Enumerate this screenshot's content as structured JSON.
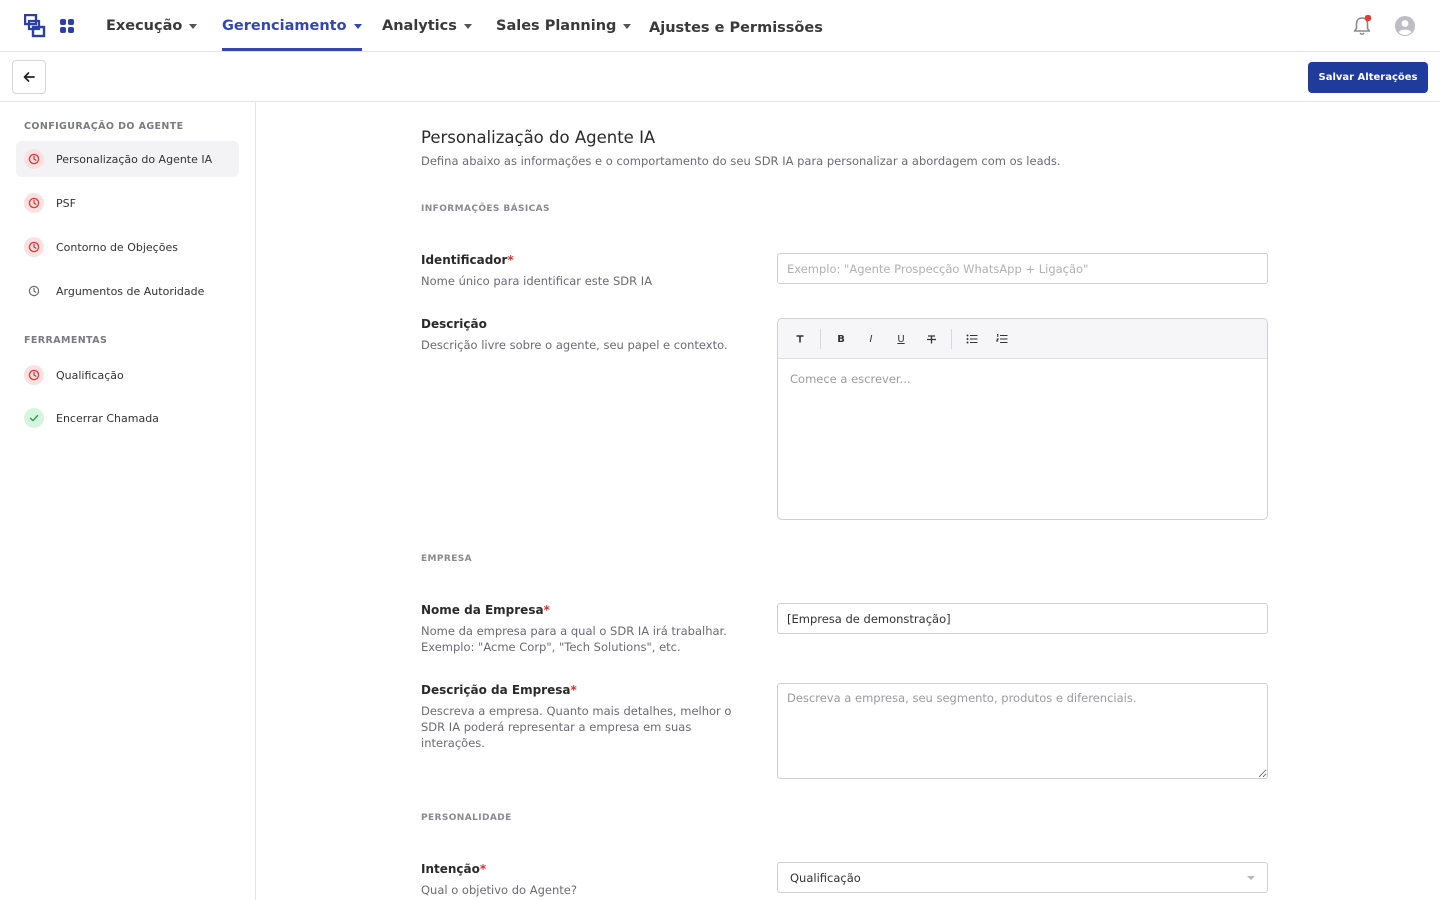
{
  "topnav": {
    "items": [
      {
        "label": "Execução",
        "has_caret": true
      },
      {
        "label": "Gerenciamento",
        "has_caret": true,
        "active": true
      },
      {
        "label": "Analytics",
        "has_caret": true
      },
      {
        "label": "Sales Planning",
        "has_caret": true
      },
      {
        "label": "Ajustes e Permissões",
        "has_caret": false
      }
    ],
    "icons": [
      "logo-icon",
      "apps-grid-icon",
      "bell-icon",
      "user-avatar-icon"
    ],
    "notification_dot_color": "#e53935",
    "accent_color": "#3346b4"
  },
  "toolbar": {
    "back_icon": "arrow-left-icon",
    "save_label": "Salvar Alterações",
    "save_color": "#1f3b9b"
  },
  "sidebar": {
    "sections": [
      {
        "heading": "CONFIGURAÇÃO DO AGENTE",
        "items": [
          {
            "label": "Personalização do Agente IA",
            "status": "pending",
            "active": true
          },
          {
            "label": "PSF",
            "status": "pending"
          },
          {
            "label": "Contorno de Objeções",
            "status": "pending"
          },
          {
            "label": "Argumentos de Autoridade",
            "status": "neutral"
          }
        ]
      },
      {
        "heading": "FERRAMENTAS",
        "items": [
          {
            "label": "Qualificação",
            "status": "pending"
          },
          {
            "label": "Encerrar Chamada",
            "status": "done"
          }
        ]
      }
    ]
  },
  "main": {
    "title": "Personalização do Agente IA",
    "subtitle": "Defina abaixo as informações e o comportamento do seu SDR IA para personalizar a abordagem com os leads.",
    "sections": {
      "basic": "INFORMAÇÕES BÁSICAS",
      "company": "EMPRESA",
      "personality": "PERSONALIDADE"
    },
    "fields": {
      "identifier": {
        "label": "Identificador",
        "required": "*",
        "help": "Nome único para identificar este SDR IA",
        "placeholder": "Exemplo: \"Agente Prospecção WhatsApp + Ligação\"",
        "value": ""
      },
      "description": {
        "label": "Descrição",
        "help": "Descrição livre sobre o agente, seu papel e contexto.",
        "placeholder": "Comece a escrever...",
        "toolbar": [
          {
            "glyph": "T",
            "name": "text-format-icon"
          },
          {
            "glyph": "B",
            "name": "bold-icon"
          },
          {
            "glyph": "I",
            "name": "italic-icon"
          },
          {
            "glyph": "U",
            "name": "underline-icon"
          },
          {
            "glyph": "S",
            "name": "strikethrough-icon"
          },
          {
            "glyph": "",
            "name": "bullet-list-icon"
          },
          {
            "glyph": "",
            "name": "numbered-list-icon"
          }
        ]
      },
      "company_name": {
        "label": "Nome da Empresa",
        "required": "*",
        "help": "Nome da empresa para a qual o SDR IA irá trabalhar. Exemplo: \"Acme Corp\", \"Tech Solutions\", etc.",
        "value": "[Empresa de demonstração]"
      },
      "company_description": {
        "label": "Descrição da Empresa",
        "required": "*",
        "help": "Descreva a empresa. Quanto mais detalhes, melhor o SDR IA poderá representar a empresa em suas interações.",
        "placeholder": "Descreva a empresa, seu segmento, produtos e diferenciais."
      },
      "intent": {
        "label": "Intenção",
        "required": "*",
        "help": "Qual o objetivo do Agente?",
        "selected": "Qualificação"
      }
    }
  }
}
